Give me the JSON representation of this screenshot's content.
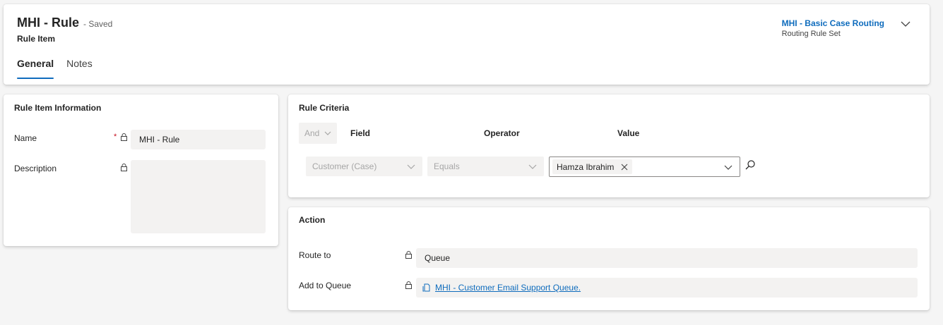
{
  "header": {
    "title": "MHI - Rule",
    "status": "- Saved",
    "entity": "Rule Item",
    "tabs": [
      {
        "label": "General",
        "active": true
      },
      {
        "label": "Notes",
        "active": false
      }
    ],
    "ruleset_link": "MHI - Basic Case Routing",
    "ruleset_type": "Routing Rule Set"
  },
  "info": {
    "title": "Rule Item Information",
    "name_label": "Name",
    "name_value": "MHI - Rule",
    "required_mark": "*",
    "description_label": "Description",
    "description_value": ""
  },
  "criteria": {
    "title": "Rule Criteria",
    "and_label": "And",
    "col_field": "Field",
    "col_operator": "Operator",
    "col_value": "Value",
    "field_value": "Customer (Case)",
    "operator_value": "Equals",
    "value_tag": "Hamza Ibrahim"
  },
  "action": {
    "title": "Action",
    "route_label": "Route to",
    "route_value": "Queue",
    "queue_label": "Add to Queue",
    "queue_value": "MHI - Customer Email Support Queue."
  },
  "colors": {
    "accent": "#0f6cbd",
    "required": "#c50f1f",
    "field_bg": "#f3f2f1"
  }
}
